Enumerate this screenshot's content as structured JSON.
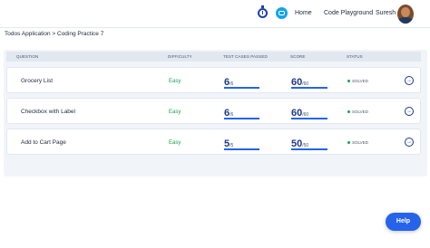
{
  "nav": {
    "home": "Home",
    "playground": "Code Playground",
    "user": "Suresh"
  },
  "breadcrumb": "Todos Application > Coding Practice 7",
  "table": {
    "headers": [
      "QUESTION",
      "DIFFICULTY",
      "TEST CASES PASSED",
      "SCORE",
      "STATUS"
    ],
    "rows": [
      {
        "question": "Grocery List",
        "difficulty": "Easy",
        "passed": "6",
        "passed_total": "/6",
        "passed_fraction": 1.0,
        "score": "60",
        "score_total": "/60",
        "score_fraction": 1.0,
        "status": "SOLVED"
      },
      {
        "question": "Checkbox with Label",
        "difficulty": "Easy",
        "passed": "6",
        "passed_total": "/6",
        "passed_fraction": 1.0,
        "score": "60",
        "score_total": "/60",
        "score_fraction": 1.0,
        "status": "SOLVED"
      },
      {
        "question": "Add to Cart Page",
        "difficulty": "Easy",
        "passed": "5",
        "passed_total": "/5",
        "passed_fraction": 1.0,
        "score": "50",
        "score_total": "/50",
        "score_fraction": 1.0,
        "status": "SOLVED"
      }
    ]
  },
  "help_label": "Help",
  "icons": {
    "timer": "timer-icon",
    "chat": "chat-icon",
    "open": "arrow-right-circle-icon"
  },
  "colors": {
    "accent": "#2563eb",
    "easy": "#16a34a",
    "solved_dot": "#16a34a",
    "chat": "#0ea5e9"
  }
}
